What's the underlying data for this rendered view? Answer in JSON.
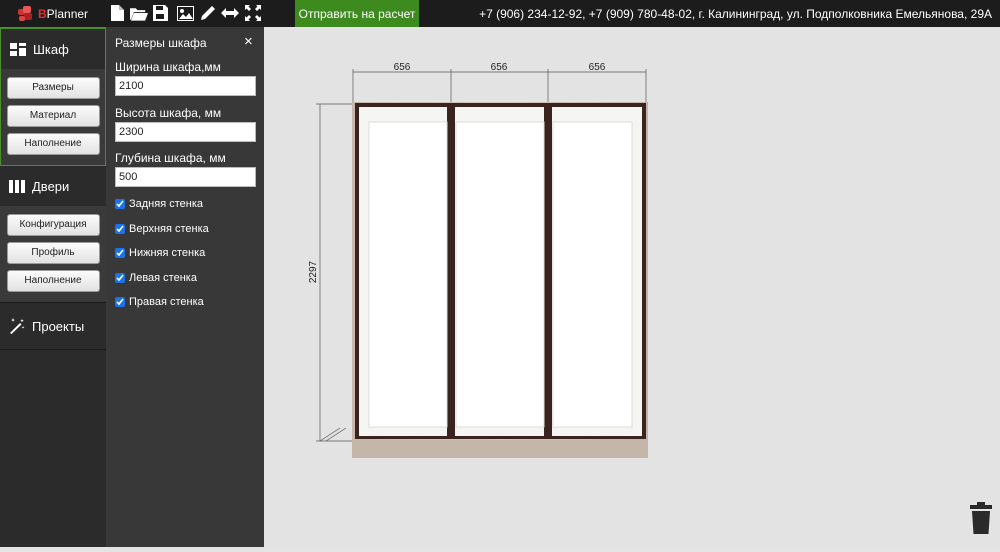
{
  "topbar": {
    "logo_text": "BPlanner",
    "logo_initial": "B",
    "logo_rest": "Planner",
    "send_button": "Отправить на расчет",
    "contact": "+7 (906) 234-12-92, +7 (909) 780-48-02, г. Калининград, ул. Подполковника Емельянова, 29А",
    "tools": [
      "new-file-icon",
      "open-folder-icon",
      "save-icon",
      "image-icon",
      "pencil-icon",
      "resize-arrows-icon",
      "fullscreen-icon"
    ]
  },
  "sidebar": {
    "wardrobe": {
      "label": "Шкаф",
      "items": [
        "Размеры",
        "Материал",
        "Наполнение"
      ]
    },
    "doors": {
      "label": "Двери",
      "items": [
        "Конфигурация",
        "Профиль",
        "Наполнение"
      ]
    },
    "projects": {
      "label": "Проекты"
    }
  },
  "panel": {
    "title": "Размеры шкафа",
    "close": "×",
    "width_label": "Ширина шкафа,мм",
    "width_value": "2100",
    "height_label": "Высота шкафа, мм",
    "height_value": "2300",
    "depth_label": "Глубина шкафа, мм",
    "depth_value": "500",
    "checks": [
      {
        "label": "Задняя стенка",
        "checked": true
      },
      {
        "label": "Верхняя стенка",
        "checked": true
      },
      {
        "label": "Нижняя стенка",
        "checked": true
      },
      {
        "label": "Левая стенка",
        "checked": true
      },
      {
        "label": "Правая стенка",
        "checked": true
      }
    ]
  },
  "drawing": {
    "section_width_1": "656",
    "section_width_2": "656",
    "section_width_3": "656",
    "height_dim": "2297"
  },
  "colors": {
    "accent_green": "#3d8a1e",
    "frame": "#3b2320",
    "carcass": "#c9bcae",
    "checkbox": "#1a73e8"
  }
}
